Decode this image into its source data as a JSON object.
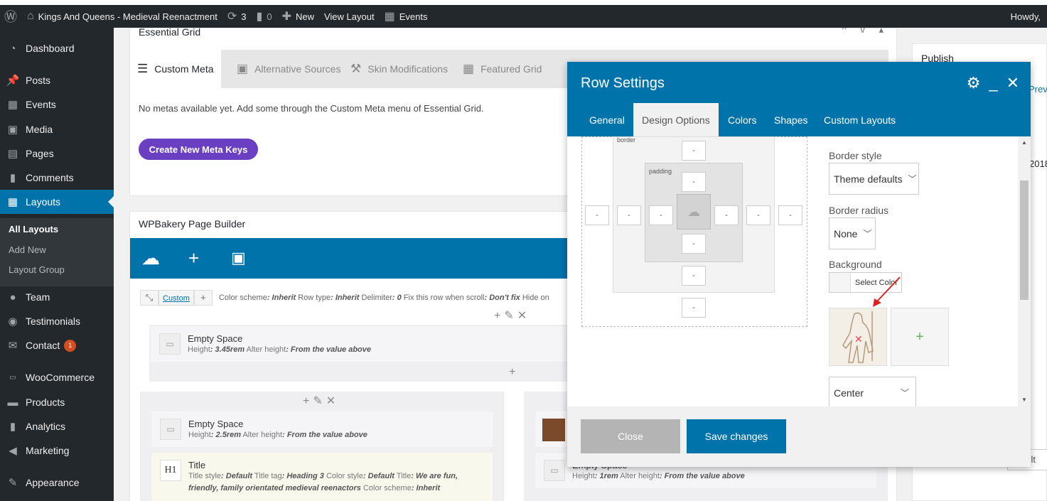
{
  "adminbar": {
    "site_name": "Kings And Queens - Medieval Reenactment",
    "updates_count": "3",
    "comments_count": "0",
    "new_label": "New",
    "view_layout_label": "View Layout",
    "events_label": "Events",
    "howdy": "Howdy,"
  },
  "sidebar": {
    "items": [
      {
        "label": "Dashboard",
        "icon": "dashboard-icon"
      },
      {
        "label": "Posts",
        "icon": "pin-icon"
      },
      {
        "label": "Events",
        "icon": "calendar-icon"
      },
      {
        "label": "Media",
        "icon": "media-icon"
      },
      {
        "label": "Pages",
        "icon": "pages-icon"
      },
      {
        "label": "Comments",
        "icon": "comment-icon"
      },
      {
        "label": "Layouts",
        "icon": "layouts-icon"
      },
      {
        "label": "Team",
        "icon": "user-icon"
      },
      {
        "label": "Testimonials",
        "icon": "testimonial-icon"
      },
      {
        "label": "Contact",
        "icon": "mail-icon",
        "badge": "1"
      },
      {
        "label": "WooCommerce",
        "icon": "woo-icon"
      },
      {
        "label": "Products",
        "icon": "archive-icon"
      },
      {
        "label": "Analytics",
        "icon": "chart-icon"
      },
      {
        "label": "Marketing",
        "icon": "megaphone-icon"
      },
      {
        "label": "Appearance",
        "icon": "brush-icon"
      }
    ],
    "submenu": [
      "All Layouts",
      "Add New",
      "Layout Group"
    ]
  },
  "essential_grid": {
    "title": "Essential Grid",
    "tabs": [
      "Custom Meta",
      "Alternative Sources",
      "Skin Modifications",
      "Featured Grid"
    ],
    "message": "No metas available yet. Add some through the Custom Meta menu of Essential Grid.",
    "button": "Create New Meta Keys"
  },
  "wpbakery": {
    "title": "WPBakery Page Builder",
    "row": {
      "custom_label": "Custom",
      "p1": "Color scheme",
      "v1": ": Inherit",
      "p2": " Row type",
      "v2": ": Inherit",
      "p3": " Delimiter",
      "v3": ": 0",
      "p4": " Fix this row when scroll",
      "v4": ": Don't fix",
      "p5": " Hide on"
    },
    "elements": [
      {
        "name": "Empty Space",
        "p1": "Height",
        "v1": ": 3.45rem",
        "p2": " Alter height",
        "v2": ": From the value above"
      },
      {
        "name": "Empty Space",
        "p1": "Height",
        "v1": ": 2.5rem",
        "p2": " Alter height",
        "v2": ": From the value above"
      },
      {
        "name": "Title",
        "p1": "Title style",
        "v1": ": Default",
        "p2": " Title tag",
        "v2": ": Heading 3",
        "p3": " Color style",
        "v3": ": Default",
        "p4": " Title",
        "v4": ": We are fun,",
        "line2_v": "friendly, family orientated medieval reenactors",
        "p5": " Color scheme",
        "v5": ": Inherit"
      },
      {
        "name": "Empty Space",
        "p1": "Height",
        "v1": ": 1rem",
        "p2": " Alter height",
        "v2": ": From the value above"
      }
    ]
  },
  "right_panel": {
    "publish": "Publish",
    "preview": "Previ",
    "year": "2018",
    "default_partial": "ault"
  },
  "modal": {
    "title": "Row Settings",
    "tabs": [
      "General",
      "Design Options",
      "Colors",
      "Shapes",
      "Custom Layouts"
    ],
    "box": {
      "border_label": "border",
      "padding_label": "padding",
      "placeholder": "-"
    },
    "border_style_label": "Border style",
    "border_style_value": "Theme defaults",
    "border_radius_label": "Border radius",
    "border_radius_value": "None",
    "background_label": "Background",
    "select_color": "Select Color",
    "position_value": "Center",
    "close_label": "Close",
    "save_label": "Save changes"
  },
  "colors": {
    "accent": "#0073aa",
    "admin_dark": "#23282d",
    "purple": "#6b3fc1",
    "badge": "#d54e21"
  }
}
